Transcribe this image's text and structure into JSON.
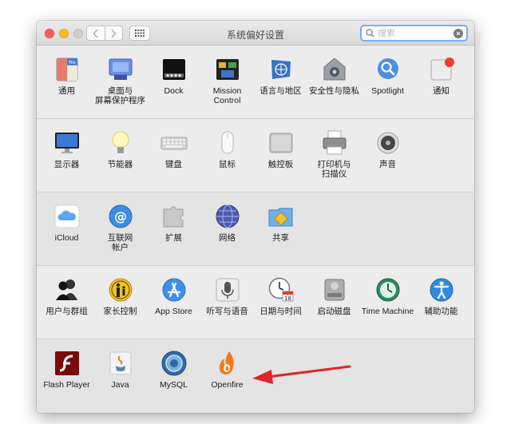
{
  "window": {
    "title": "系统偏好设置",
    "search_placeholder": "搜索"
  },
  "rows": [
    [
      {
        "label": "通用",
        "icon": "general-icon"
      },
      {
        "label": "桌面与\n屏幕保护程序",
        "icon": "desktop-screensaver-icon"
      },
      {
        "label": "Dock",
        "icon": "dock-icon"
      },
      {
        "label": "Mission\nControl",
        "icon": "mission-control-icon"
      },
      {
        "label": "语言与地区",
        "icon": "language-region-icon"
      },
      {
        "label": "安全性与隐私",
        "icon": "security-privacy-icon"
      },
      {
        "label": "Spotlight",
        "icon": "spotlight-icon"
      },
      {
        "label": "通知",
        "icon": "notifications-icon"
      }
    ],
    [
      {
        "label": "显示器",
        "icon": "displays-icon"
      },
      {
        "label": "节能器",
        "icon": "energy-saver-icon"
      },
      {
        "label": "键盘",
        "icon": "keyboard-icon"
      },
      {
        "label": "鼠标",
        "icon": "mouse-icon"
      },
      {
        "label": "触控板",
        "icon": "trackpad-icon"
      },
      {
        "label": "打印机与\n扫描仪",
        "icon": "printers-scanners-icon"
      },
      {
        "label": "声音",
        "icon": "sound-icon"
      }
    ],
    [
      {
        "label": "iCloud",
        "icon": "icloud-icon"
      },
      {
        "label": "互联网\n帐户",
        "icon": "internet-accounts-icon"
      },
      {
        "label": "扩展",
        "icon": "extensions-icon"
      },
      {
        "label": "网络",
        "icon": "network-icon"
      },
      {
        "label": "共享",
        "icon": "sharing-icon"
      }
    ],
    [
      {
        "label": "用户与群组",
        "icon": "users-groups-icon"
      },
      {
        "label": "家长控制",
        "icon": "parental-controls-icon"
      },
      {
        "label": "App Store",
        "icon": "app-store-icon"
      },
      {
        "label": "听写与语音",
        "icon": "dictation-speech-icon"
      },
      {
        "label": "日期与时间",
        "icon": "date-time-icon"
      },
      {
        "label": "启动磁盘",
        "icon": "startup-disk-icon"
      },
      {
        "label": "Time Machine",
        "icon": "time-machine-icon"
      },
      {
        "label": "辅助功能",
        "icon": "accessibility-icon"
      }
    ],
    [
      {
        "label": "Flash Player",
        "icon": "flash-player-icon"
      },
      {
        "label": "Java",
        "icon": "java-icon"
      },
      {
        "label": "MySQL",
        "icon": "mysql-icon"
      },
      {
        "label": "Openfire",
        "icon": "openfire-icon"
      }
    ]
  ],
  "colors": {
    "accent_red_arrow": "#e0262b",
    "search_focus": "#78aef0"
  }
}
